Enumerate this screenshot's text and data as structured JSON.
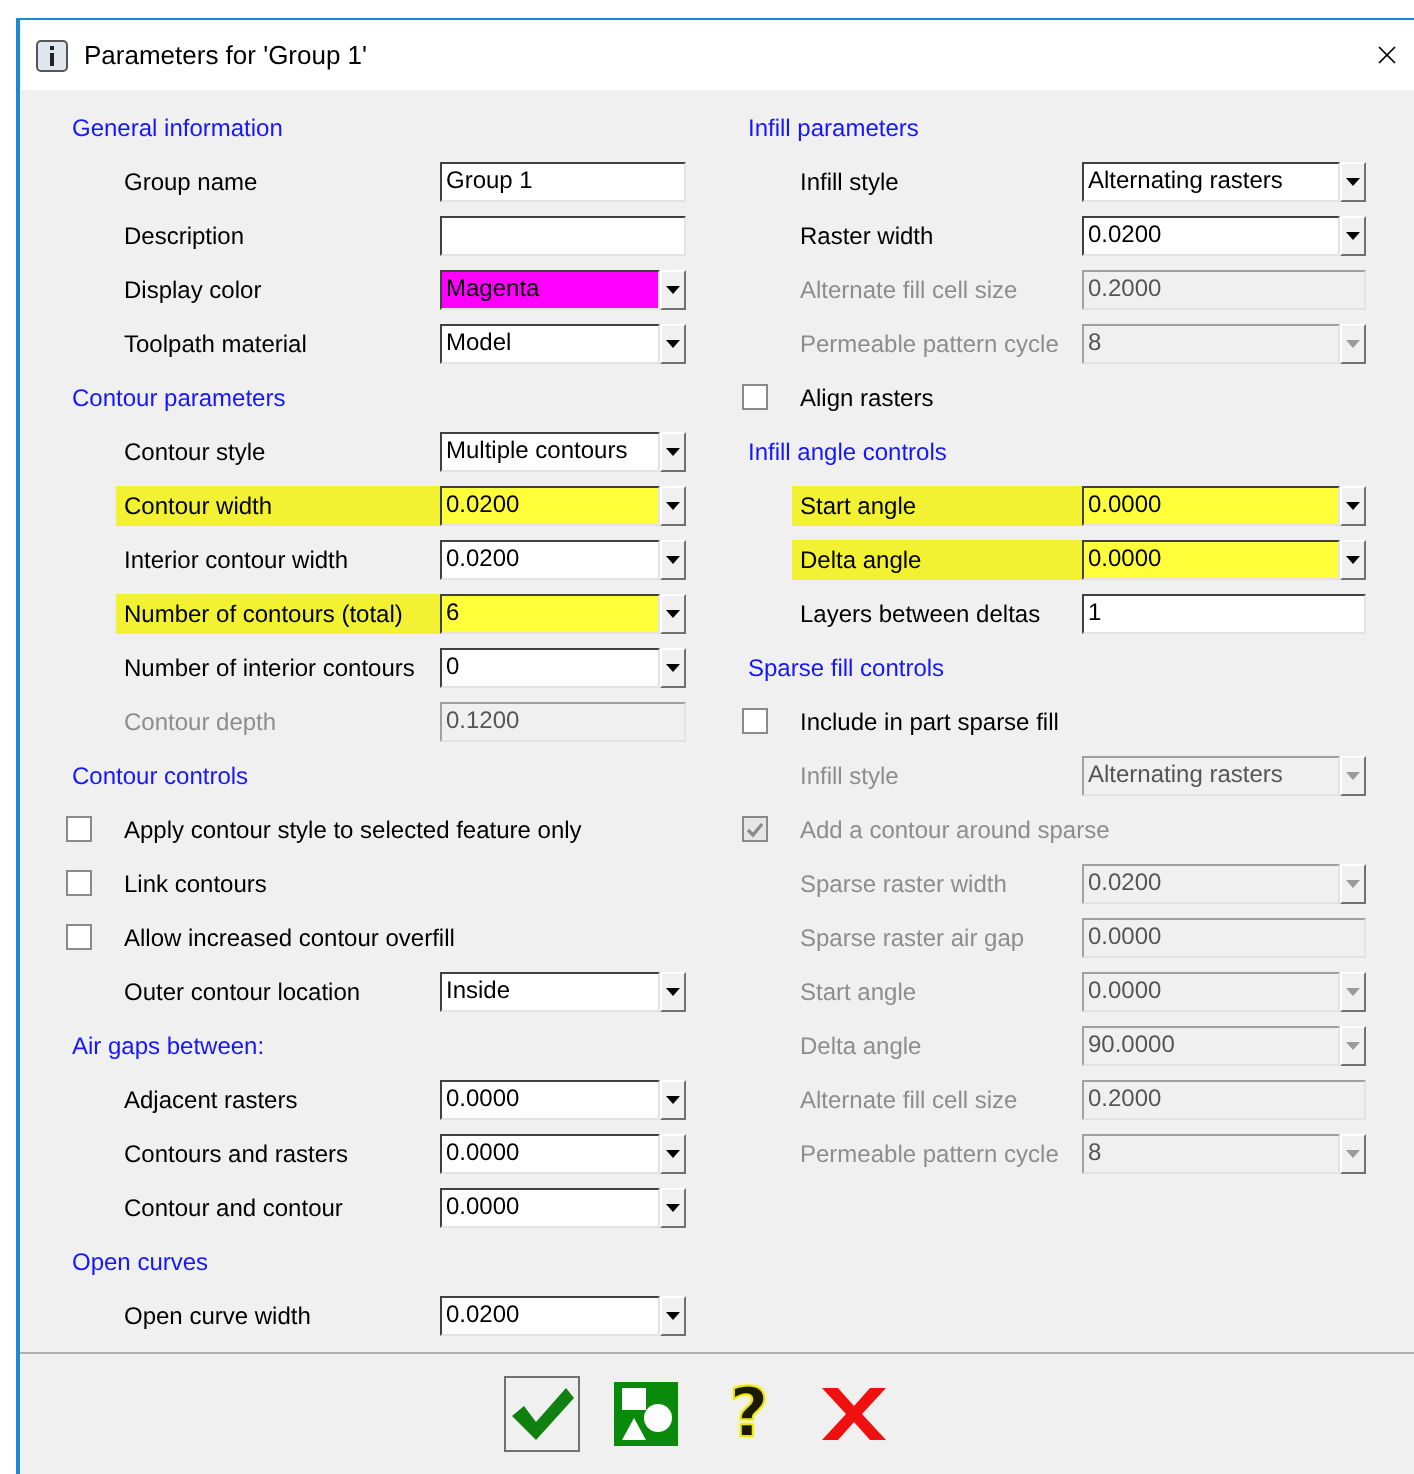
{
  "window": {
    "title": "Parameters for 'Group 1'"
  },
  "left_column": [
    {
      "kind": "heading",
      "label": "General information"
    },
    {
      "kind": "text",
      "label": "Group name",
      "value": "Group 1",
      "disabled": false,
      "highlighted": false
    },
    {
      "kind": "text",
      "label": "Description",
      "disabled": false,
      "highlighted": false
    },
    {
      "kind": "combo",
      "label": "Display color",
      "value": "Magenta",
      "color": "#ff00ff",
      "disabled": false,
      "highlighted": false
    },
    {
      "kind": "combo",
      "label": "Toolpath material",
      "value": "Model",
      "disabled": false,
      "highlighted": false
    },
    {
      "kind": "heading",
      "label": "Contour parameters"
    },
    {
      "kind": "combo",
      "label": "Contour style",
      "value": "Multiple contours",
      "disabled": false,
      "highlighted": false
    },
    {
      "kind": "combo",
      "label": "Contour width",
      "value": "0.0200",
      "disabled": false,
      "highlighted": true
    },
    {
      "kind": "combo",
      "label": "Interior contour width",
      "value": "0.0200",
      "disabled": false,
      "highlighted": false
    },
    {
      "kind": "combo",
      "label": "Number of contours (total)",
      "value": "6",
      "disabled": false,
      "highlighted": true
    },
    {
      "kind": "combo",
      "label": "Number of interior contours",
      "value": "0",
      "disabled": false,
      "highlighted": false
    },
    {
      "kind": "text",
      "label": "Contour depth",
      "value": "0.1200",
      "disabled": true,
      "highlighted": false
    },
    {
      "kind": "heading",
      "label": "Contour controls"
    },
    {
      "kind": "checkbox",
      "label": "Apply contour style to selected feature only",
      "checked": false,
      "disabled": false
    },
    {
      "kind": "checkbox",
      "label": "Link contours",
      "checked": false,
      "disabled": false
    },
    {
      "kind": "checkbox",
      "label": "Allow increased contour overfill",
      "checked": false,
      "disabled": false
    },
    {
      "kind": "combo",
      "label": "Outer contour location",
      "value": "Inside",
      "disabled": false,
      "highlighted": false
    },
    {
      "kind": "heading",
      "label": "Air gaps between:"
    },
    {
      "kind": "combo",
      "label": "Adjacent rasters",
      "value": "0.0000",
      "disabled": false,
      "highlighted": false
    },
    {
      "kind": "combo",
      "label": "Contours and rasters",
      "value": "0.0000",
      "disabled": false,
      "highlighted": false
    },
    {
      "kind": "combo",
      "label": "Contour and contour",
      "value": "0.0000",
      "disabled": false,
      "highlighted": false
    },
    {
      "kind": "heading",
      "label": "Open curves"
    },
    {
      "kind": "combo",
      "label": "Open curve width",
      "value": "0.0200",
      "disabled": false,
      "highlighted": false
    }
  ],
  "right_column": [
    {
      "kind": "heading",
      "label": "Infill parameters"
    },
    {
      "kind": "combo",
      "label": "Infill style",
      "value": "Alternating rasters",
      "disabled": false,
      "highlighted": false
    },
    {
      "kind": "combo",
      "label": "Raster width",
      "value": "0.0200",
      "disabled": false,
      "highlighted": false
    },
    {
      "kind": "text",
      "label": "Alternate fill cell size",
      "value": "0.2000",
      "disabled": true,
      "highlighted": false
    },
    {
      "kind": "combo",
      "label": "Permeable pattern cycle",
      "value": "8",
      "disabled": true,
      "highlighted": false
    },
    {
      "kind": "checkbox",
      "label": "Align rasters",
      "checked": false,
      "disabled": false
    },
    {
      "kind": "heading",
      "label": "Infill angle controls"
    },
    {
      "kind": "combo",
      "label": "Start angle",
      "value": "0.0000",
      "disabled": false,
      "highlighted": true
    },
    {
      "kind": "combo",
      "label": "Delta angle",
      "value": "0.0000",
      "disabled": false,
      "highlighted": true
    },
    {
      "kind": "text",
      "label": "Layers between deltas",
      "value": "1",
      "disabled": false,
      "highlighted": false
    },
    {
      "kind": "heading",
      "label": "Sparse fill controls"
    },
    {
      "kind": "checkbox",
      "label": "Include in part sparse fill",
      "checked": false,
      "disabled": false
    },
    {
      "kind": "combo",
      "label": "Infill style",
      "value": "Alternating rasters",
      "disabled": true,
      "highlighted": false
    },
    {
      "kind": "checkbox",
      "label": "Add a contour around sparse",
      "checked": true,
      "disabled": true
    },
    {
      "kind": "combo",
      "label": "Sparse raster width",
      "value": "0.0200",
      "disabled": true,
      "highlighted": false
    },
    {
      "kind": "text",
      "label": "Sparse raster air gap",
      "value": "0.0000",
      "disabled": true,
      "highlighted": false
    },
    {
      "kind": "combo",
      "label": "Start angle",
      "value": "0.0000",
      "disabled": true,
      "highlighted": false
    },
    {
      "kind": "combo",
      "label": "Delta angle",
      "value": "90.0000",
      "disabled": true,
      "highlighted": false
    },
    {
      "kind": "text",
      "label": "Alternate fill cell size",
      "value": "0.2000",
      "disabled": true,
      "highlighted": false
    },
    {
      "kind": "combo",
      "label": "Permeable pattern cycle",
      "value": "8",
      "disabled": true,
      "highlighted": false
    }
  ],
  "footer_buttons": [
    {
      "kind": "ok"
    },
    {
      "kind": "shapes"
    },
    {
      "kind": "help",
      "label": "?"
    },
    {
      "kind": "cancel"
    }
  ]
}
